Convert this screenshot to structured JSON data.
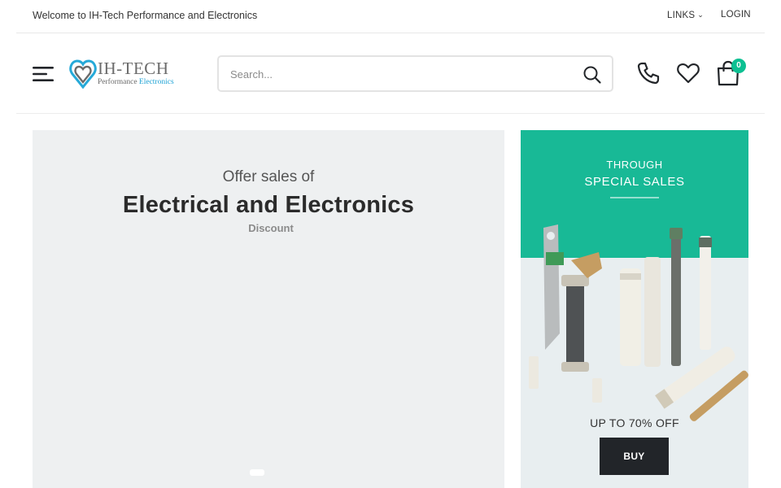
{
  "topbar": {
    "welcome": "Welcome to IH-Tech Performance and Electronics",
    "links_label": "LINKS",
    "login_label": "LOGIN"
  },
  "header": {
    "logo_wordmark": "IH-TECH",
    "logo_tag_part1": "Performance",
    "logo_tag_part2": "Electronics",
    "search_placeholder": "Search...",
    "cart_count": "0",
    "accent_color": "#0cc092"
  },
  "hero": {
    "subtitle": "Offer sales of",
    "title": "Electrical and Electronics",
    "note": "Discount",
    "background": "#eef0f1"
  },
  "promo": {
    "kicker": "THROUGH",
    "title": "SPECIAL SALES",
    "offer": "UP TO 70% OFF",
    "buy_label": "BUY",
    "band_color": "#18b996"
  },
  "icons": [
    "menu-icon",
    "logo-heart-icon",
    "search-icon",
    "phone-icon",
    "heart-icon",
    "cart-icon",
    "chevron-down-icon"
  ]
}
